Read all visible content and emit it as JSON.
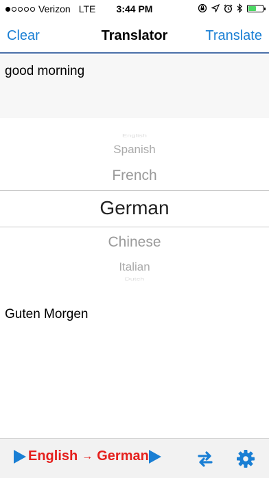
{
  "status_bar": {
    "carrier": "Verizon",
    "network": "LTE",
    "time": "3:44 PM",
    "signal_bars": 1,
    "battery_level": 0.55,
    "battery_color": "#4cd964"
  },
  "navbar": {
    "left_button": "Clear",
    "title": "Translator",
    "right_button": "Translate",
    "accent_color": "#1a7fd4"
  },
  "input": {
    "text": "good morning"
  },
  "picker": {
    "options": [
      "English",
      "Spanish",
      "French",
      "German",
      "Chinese",
      "Italian",
      "Dutch"
    ],
    "selected": "German"
  },
  "output": {
    "text": "Guten Morgen"
  },
  "toolbar": {
    "from_language": "English",
    "arrow": "→",
    "to_language": "German",
    "icons": [
      "play-triangle-icon",
      "swap-icon",
      "gear-icon"
    ],
    "language_color": "#e5201d"
  }
}
